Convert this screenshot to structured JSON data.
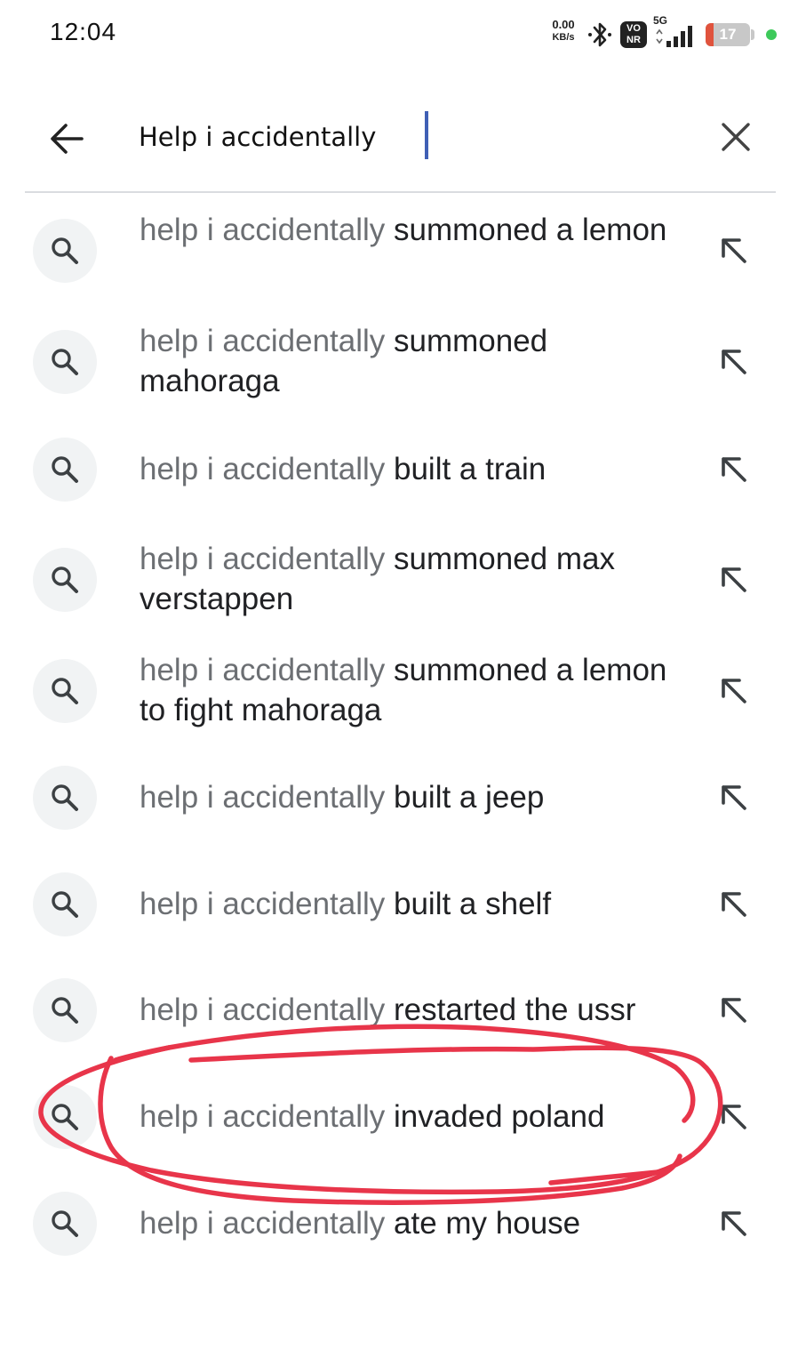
{
  "status_bar": {
    "time": "12:04",
    "net_speed_value": "0.00",
    "net_speed_unit": "KB/s",
    "vonr_line1": "VO",
    "vonr_line2": "NR",
    "network_type": "5G",
    "battery_percent": "17",
    "battery_level": 0.17,
    "icons": [
      "bluetooth-icon",
      "signal-icon",
      "battery-icon",
      "privacy-dot"
    ]
  },
  "search": {
    "query": "Help i accidentally",
    "back_icon": "arrow-left-icon",
    "clear_icon": "close-icon"
  },
  "suggestions": [
    {
      "query": "help i accidentally",
      "completion": " summoned a lemon"
    },
    {
      "query": "help i accidentally",
      "completion": " summoned mahoraga"
    },
    {
      "query": "help i accidentally",
      "completion": " built a train"
    },
    {
      "query": "help i accidentally",
      "completion": " summoned max verstappen"
    },
    {
      "query": "help i accidentally",
      "completion": " summoned a lemon to fight mahoraga"
    },
    {
      "query": "help i accidentally",
      "completion": " built a jeep"
    },
    {
      "query": "help i accidentally",
      "completion": " built a shelf"
    },
    {
      "query": "help i accidentally",
      "completion": " restarted the ussr"
    },
    {
      "query": "help i accidentally",
      "completion": " invaded poland"
    },
    {
      "query": "help i accidentally",
      "completion": " ate my house"
    }
  ],
  "suggestion_icons": {
    "leading": "search-icon",
    "trailing": "arrow-up-left-icon"
  },
  "colors": {
    "accent_caret": "#3f5fb5",
    "annotation_red": "#e8354a",
    "query_gray": "#6c6f73",
    "completion_dark": "#202124"
  }
}
